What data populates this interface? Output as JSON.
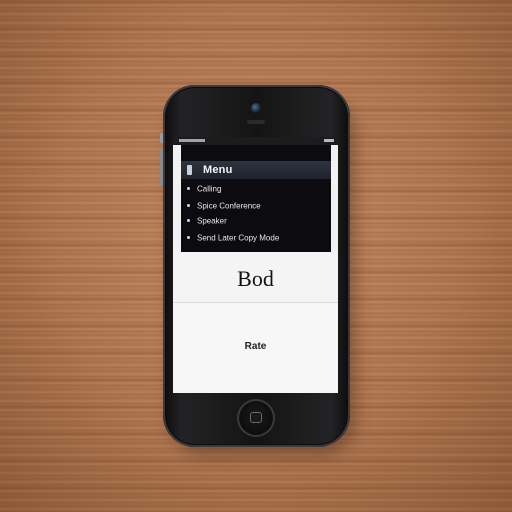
{
  "device": {
    "type": "smartphone",
    "screen": {
      "menu": {
        "title": "Menu",
        "items": [
          {
            "label": "Calling"
          },
          {
            "label": "Spice Conference"
          },
          {
            "label": "Speaker"
          },
          {
            "label": "Send Later Copy Mode"
          }
        ]
      },
      "middle_label": "Bod",
      "lower_label": "Rate"
    }
  },
  "colors": {
    "wood": "#b27a52",
    "phone_body": "#141415",
    "screen_bg": "#f2f2f2",
    "menu_bg": "#0c0c10",
    "menu_header": "#2e3440"
  },
  "icons": [
    "info-icon",
    "bullet-icon",
    "camera-icon",
    "home-square-icon"
  ]
}
